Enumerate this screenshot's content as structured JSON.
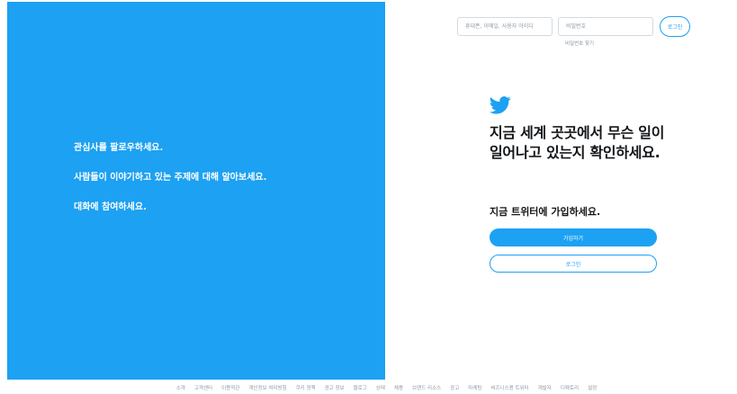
{
  "left": {
    "features": [
      "관심사를 팔로우하세요.",
      "사람들이 이야기하고 있는 주제에 대해 알아보세요.",
      "대화에 참여하세요."
    ]
  },
  "login_bar": {
    "username_placeholder": "휴대폰, 이메일, 사용자 아이디",
    "password_placeholder": "비밀번호",
    "forgot_label": "비밀번호 찾기",
    "login_label": "로그인"
  },
  "main": {
    "logo_icon": "twitter-bird-icon",
    "headline": "지금 세계 곳곳에서 무슨 일이 일어나고 있는지 확인하세요.",
    "join_title": "지금 트위터에 가입하세요.",
    "signup_label": "가입하기",
    "login_label": "로그인"
  },
  "footer": {
    "links": [
      "소개",
      "고객센터",
      "이용약관",
      "개인정보 처리방침",
      "쿠키 정책",
      "광고 정보",
      "블로그",
      "상태",
      "채용",
      "브랜드 리소스",
      "광고",
      "마케팅",
      "비즈니스용 트위터",
      "개발자",
      "디렉토리",
      "설정"
    ]
  },
  "colors": {
    "brand": "#1da1f2",
    "text": "#14171a",
    "muted": "#8899a6"
  }
}
